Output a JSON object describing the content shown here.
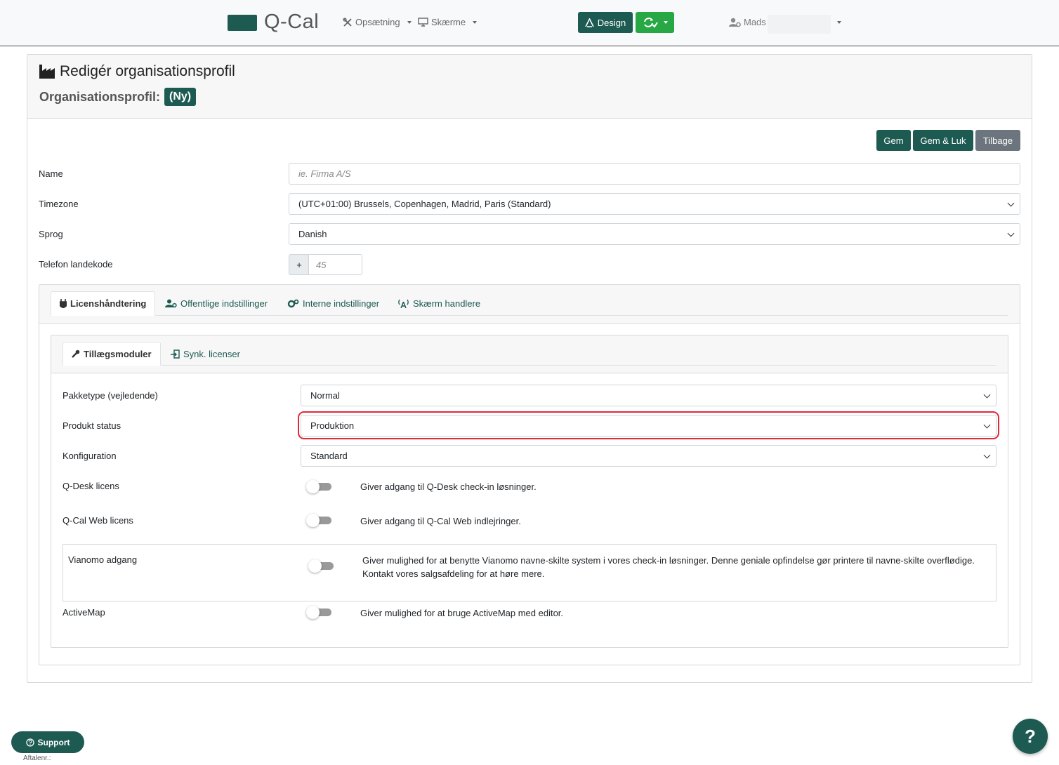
{
  "navbar": {
    "logo_text": "Q-Cal",
    "menu_setup": "Opsætning",
    "menu_screens": "Skærme",
    "design_button": "Design",
    "user_name": "Mads"
  },
  "header": {
    "title": "Redigér organisationsprofil",
    "subtitle": "Organisationsprofil:",
    "badge": "(Ny)"
  },
  "actions": {
    "save": "Gem",
    "save_close": "Gem & Luk",
    "back": "Tilbage"
  },
  "form": {
    "name_label": "Name",
    "name_placeholder": "ie. Firma A/S",
    "timezone_label": "Timezone",
    "timezone_value": "(UTC+01:00) Brussels, Copenhagen, Madrid, Paris (Standard)",
    "language_label": "Sprog",
    "language_value": "Danish",
    "phone_label": "Telefon landekode",
    "phone_prefix": "+",
    "phone_placeholder": "45"
  },
  "outer_tabs": [
    {
      "label": "Licenshåndtering"
    },
    {
      "label": "Offentlige indstillinger"
    },
    {
      "label": "Interne indstillinger"
    },
    {
      "label": "Skærm handlere"
    }
  ],
  "inner_tabs": [
    {
      "label": "Tillægsmoduler"
    },
    {
      "label": "Synk. licenser"
    }
  ],
  "license": {
    "package_label": "Pakketype (vejledende)",
    "package_value": "Normal",
    "status_label": "Produkt status",
    "status_value": "Produktion",
    "config_label": "Konfiguration",
    "config_value": "Standard",
    "qdesk_label": "Q-Desk licens",
    "qdesk_desc": "Giver adgang til Q-Desk check-in løsninger.",
    "qcalweb_label": "Q-Cal Web licens",
    "qcalweb_desc": "Giver adgang til Q-Cal Web indlejringer.",
    "vianomo_label": "Vianomo adgang",
    "vianomo_desc_1": "Giver mulighed for at benytte Vianomo navne-skilte system i vores check-in løsninger. Denne geniale opfindelse gør printere til navne-skilte overflødige.",
    "vianomo_desc_2": "Kontakt vores salgsafdeling for at høre mere.",
    "activemap_label": "ActiveMap",
    "activemap_desc": "Giver mulighed for at bruge ActiveMap med editor."
  },
  "footer": {
    "support": "Support",
    "aftale": "Aftalenr.:",
    "help": "?"
  },
  "colors": {
    "brand": "#1d5a52",
    "green": "#28a745",
    "highlight": "#e0283a"
  }
}
